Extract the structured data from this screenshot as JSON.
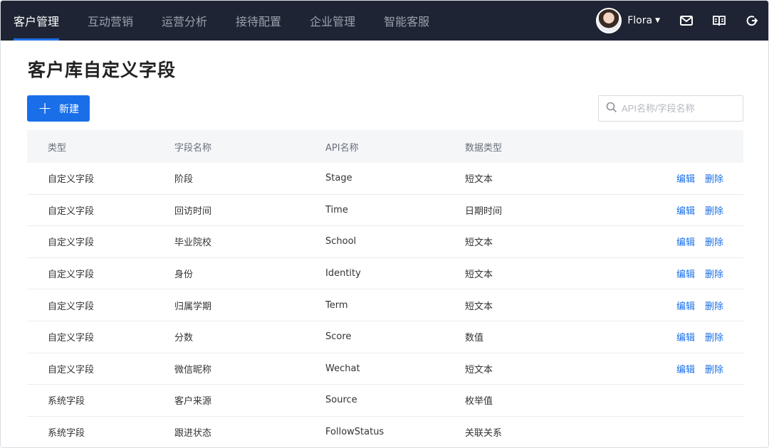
{
  "nav": {
    "items": [
      {
        "label": "客户管理",
        "active": true
      },
      {
        "label": "互动营销",
        "active": false
      },
      {
        "label": "运营分析",
        "active": false
      },
      {
        "label": "接待配置",
        "active": false
      },
      {
        "label": "企业管理",
        "active": false
      },
      {
        "label": "智能客服",
        "active": false
      }
    ],
    "user_name": "Flora",
    "icons": [
      "mail-icon",
      "book-icon",
      "logout-icon"
    ]
  },
  "page": {
    "title": "客户库自定义字段",
    "new_button": "新建",
    "search_placeholder": "API名称/字段名称"
  },
  "table": {
    "headers": [
      "类型",
      "字段名称",
      "API名称",
      "数据类型"
    ],
    "action_labels": {
      "edit": "编辑",
      "delete": "删除"
    },
    "rows": [
      {
        "type": "自定义字段",
        "name": "阶段",
        "api": "Stage",
        "data_type": "短文本",
        "editable": true
      },
      {
        "type": "自定义字段",
        "name": "回访时间",
        "api": "Time",
        "data_type": "日期时间",
        "editable": true
      },
      {
        "type": "自定义字段",
        "name": "毕业院校",
        "api": "School",
        "data_type": "短文本",
        "editable": true
      },
      {
        "type": "自定义字段",
        "name": "身份",
        "api": "Identity",
        "data_type": "短文本",
        "editable": true
      },
      {
        "type": "自定义字段",
        "name": "归属学期",
        "api": "Term",
        "data_type": "短文本",
        "editable": true
      },
      {
        "type": "自定义字段",
        "name": "分数",
        "api": "Score",
        "data_type": "数值",
        "editable": true
      },
      {
        "type": "自定义字段",
        "name": "微信昵称",
        "api": "Wechat",
        "data_type": "短文本",
        "editable": true
      },
      {
        "type": "系统字段",
        "name": "客户来源",
        "api": "Source",
        "data_type": "枚举值",
        "editable": false
      },
      {
        "type": "系统字段",
        "name": "跟进状态",
        "api": "FollowStatus",
        "data_type": "关联关系",
        "editable": false
      }
    ]
  },
  "colors": {
    "accent": "#1a6fe8",
    "topbar": "#1e2433"
  }
}
